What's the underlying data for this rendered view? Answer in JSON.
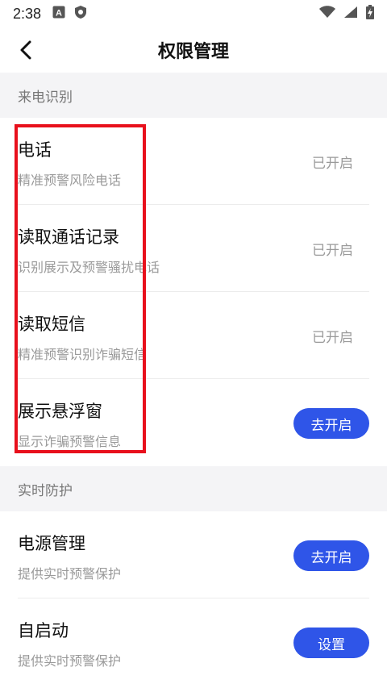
{
  "status_bar": {
    "time": "2:38",
    "left_icons": [
      "a-badge-icon",
      "shield-icon"
    ],
    "right_icons": [
      "wifi-icon",
      "signal-icon",
      "battery-charging-icon"
    ]
  },
  "nav": {
    "back_icon": "chevron-left-icon",
    "title": "权限管理"
  },
  "sections": {
    "caller_id": {
      "header": "来电识别",
      "items": [
        {
          "title": "电话",
          "subtitle": "精准预警风险电话",
          "status": "已开启"
        },
        {
          "title": "读取通话记录",
          "subtitle": "识别展示及预警骚扰电话",
          "status": "已开启"
        },
        {
          "title": "读取短信",
          "subtitle": "精准预警识别诈骗短信",
          "status": "已开启"
        },
        {
          "title": "展示悬浮窗",
          "subtitle": "显示诈骗预警信息",
          "button": "去开启"
        }
      ]
    },
    "realtime": {
      "header": "实时防护",
      "items": [
        {
          "title": "电源管理",
          "subtitle": "提供实时预警保护",
          "button": "去开启"
        },
        {
          "title": "自启动",
          "subtitle": "提供实时预警保护",
          "button": "设置"
        }
      ]
    }
  },
  "colors": {
    "accent": "#2f55e8",
    "highlight": "#e8101c",
    "section_bg": "#f4f4f6"
  }
}
